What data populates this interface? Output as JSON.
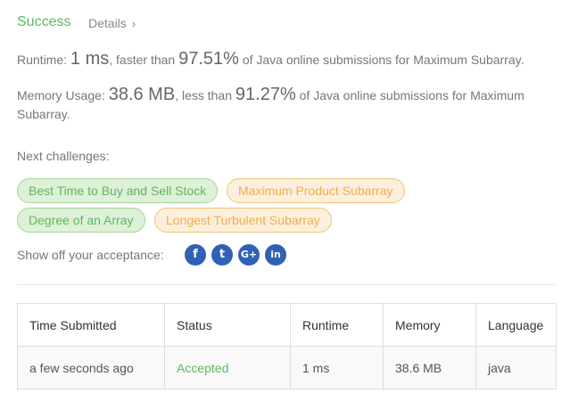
{
  "header": {
    "status": "Success",
    "details_label": "Details",
    "details_chevron": "chevron-right-icon"
  },
  "runtime": {
    "label": "Runtime:",
    "value": "1 ms",
    "faster_text": ", faster than",
    "percent": "97.51%",
    "suffix": "of Java online submissions for Maximum Subarray."
  },
  "memory": {
    "label": "Memory Usage:",
    "value": "38.6 MB",
    "less_text": ", less than",
    "percent": "91.27%",
    "suffix": "of Java online submissions for Maximum Subarray."
  },
  "next": {
    "label": "Next challenges:",
    "challenges": [
      {
        "label": "Best Time to Buy and Sell Stock",
        "difficulty": "green"
      },
      {
        "label": "Maximum Product Subarray",
        "difficulty": "orange"
      },
      {
        "label": "Degree of an Array",
        "difficulty": "green"
      },
      {
        "label": "Longest Turbulent Subarray",
        "difficulty": "orange"
      }
    ]
  },
  "share": {
    "label": "Show off your acceptance:",
    "icons": [
      "facebook-icon",
      "twitter-icon",
      "google-plus-icon",
      "linkedin-icon"
    ],
    "glyphs": [
      "f",
      "t",
      "G+",
      "in"
    ]
  },
  "table": {
    "headers": [
      "Time Submitted",
      "Status",
      "Runtime",
      "Memory",
      "Language"
    ],
    "rows": [
      [
        "a few seconds ago",
        "Accepted",
        "1 ms",
        "38.6 MB",
        "java"
      ]
    ]
  },
  "colors": {
    "success": "#5cb85c",
    "medium": "#f0ad4e",
    "social": "#2f62b4"
  }
}
